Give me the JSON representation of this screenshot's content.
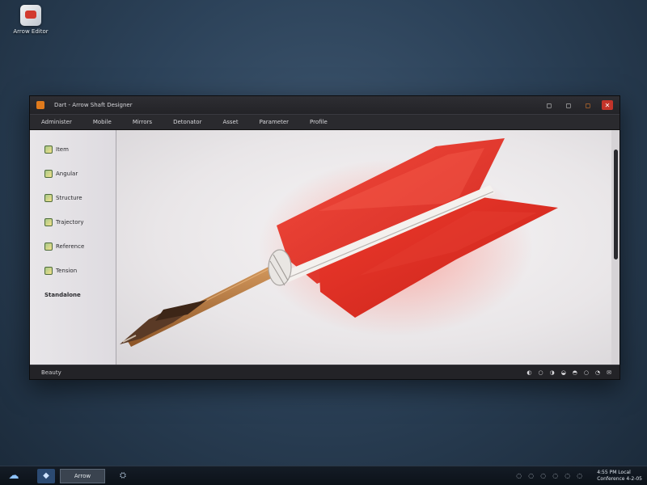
{
  "desktop": {
    "icon_label": "Arrow Editor"
  },
  "window": {
    "title": "Dart - Arrow Shaft Designer",
    "controls": [
      "◻",
      "◻",
      "◻",
      "✕"
    ],
    "menu": [
      "Administer",
      "Mobile",
      "Mirrors",
      "Detonator",
      "Asset",
      "Parameter",
      "Profile"
    ],
    "sidebar": [
      {
        "label": "Item",
        "icon": "item-icon"
      },
      {
        "label": "Angular",
        "icon": "angle-icon"
      },
      {
        "label": "Structure",
        "icon": "structure-icon"
      },
      {
        "label": "Trajectory",
        "icon": "trajectory-icon"
      },
      {
        "label": "Reference",
        "icon": "reference-icon"
      },
      {
        "label": "Tension",
        "icon": "tension-icon"
      },
      {
        "label": "Standalone",
        "icon": ""
      }
    ],
    "status": "Beauty",
    "status_icons": [
      "◐",
      "○",
      "◑",
      "◒",
      "◓",
      "○",
      "◔",
      "✉"
    ]
  },
  "canvas": {
    "subject": "arrow-feather",
    "fletching_color": "#e8332a",
    "shaft_color": "#b8793f"
  },
  "taskbar": {
    "start_glyph": "☁",
    "app_glyph": "◆",
    "active_task": "Arrow",
    "extra_glyph": "⛭",
    "tray_icons": [
      "◌",
      "◌",
      "◌",
      "◌",
      "◌",
      "◌"
    ],
    "clock_line1": "4:55 PM Local",
    "clock_line2": "Conference 4-2-05"
  }
}
